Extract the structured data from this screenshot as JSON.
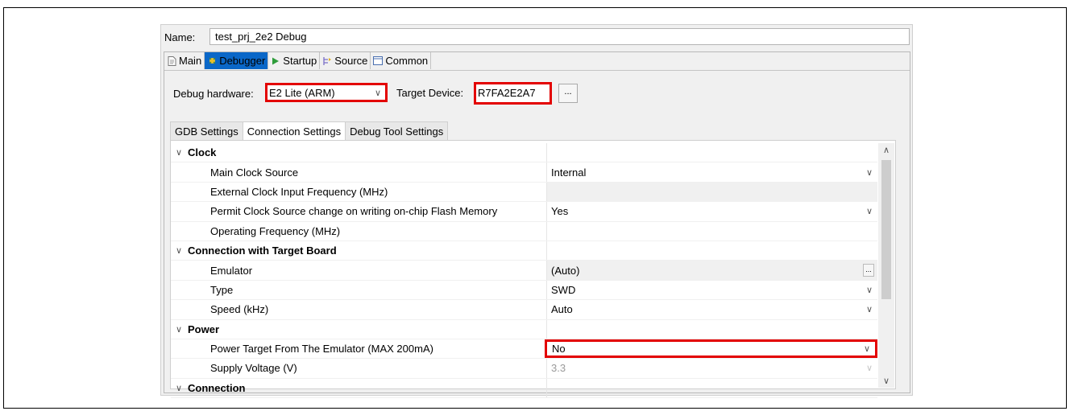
{
  "launch_config": {
    "name_label": "Name:",
    "name_value": "test_prj_2e2 Debug"
  },
  "tabs": [
    {
      "label": "Main",
      "icon": "page-icon",
      "active": false
    },
    {
      "label": "Debugger",
      "icon": "debugger-icon",
      "active": true
    },
    {
      "label": "Startup",
      "icon": "play-icon",
      "active": false
    },
    {
      "label": "Source",
      "icon": "source-lookup-icon",
      "active": false
    },
    {
      "label": "Common",
      "icon": "common-icon",
      "active": false
    }
  ],
  "debugger": {
    "hardware_label": "Debug hardware:",
    "hardware_value": "E2 Lite (ARM)",
    "target_device_label": "Target Device:",
    "target_device_value": "R7FA2E2A7",
    "browse_button": "..."
  },
  "subtabs": [
    {
      "label": "GDB Settings",
      "active": false
    },
    {
      "label": "Connection Settings",
      "active": true
    },
    {
      "label": "Debug Tool Settings",
      "active": false
    }
  ],
  "settings": {
    "clock": {
      "title": "Clock",
      "main_clock_source": {
        "label": "Main Clock Source",
        "value": "Internal"
      },
      "ext_clock_freq": {
        "label": "External Clock Input Frequency (MHz)",
        "value": ""
      },
      "permit_clock_change": {
        "label": "Permit Clock Source change on writing on-chip Flash Memory",
        "value": "Yes"
      },
      "operating_freq": {
        "label": "Operating Frequency (MHz)",
        "value": ""
      }
    },
    "connection_target": {
      "title": "Connection with Target Board",
      "emulator": {
        "label": "Emulator",
        "value": "(Auto)",
        "button": "..."
      },
      "type": {
        "label": "Type",
        "value": "SWD"
      },
      "speed": {
        "label": "Speed (kHz)",
        "value": "Auto"
      }
    },
    "power": {
      "title": "Power",
      "power_target": {
        "label": "Power Target From The Emulator (MAX 200mA)",
        "value": "No"
      },
      "supply_voltage": {
        "label": "Supply Voltage (V)",
        "value": "3.3"
      }
    },
    "connection": {
      "title": "Connection"
    }
  },
  "colors": {
    "highlight_box": "#e30000",
    "active_tab": "#0a67c8"
  }
}
